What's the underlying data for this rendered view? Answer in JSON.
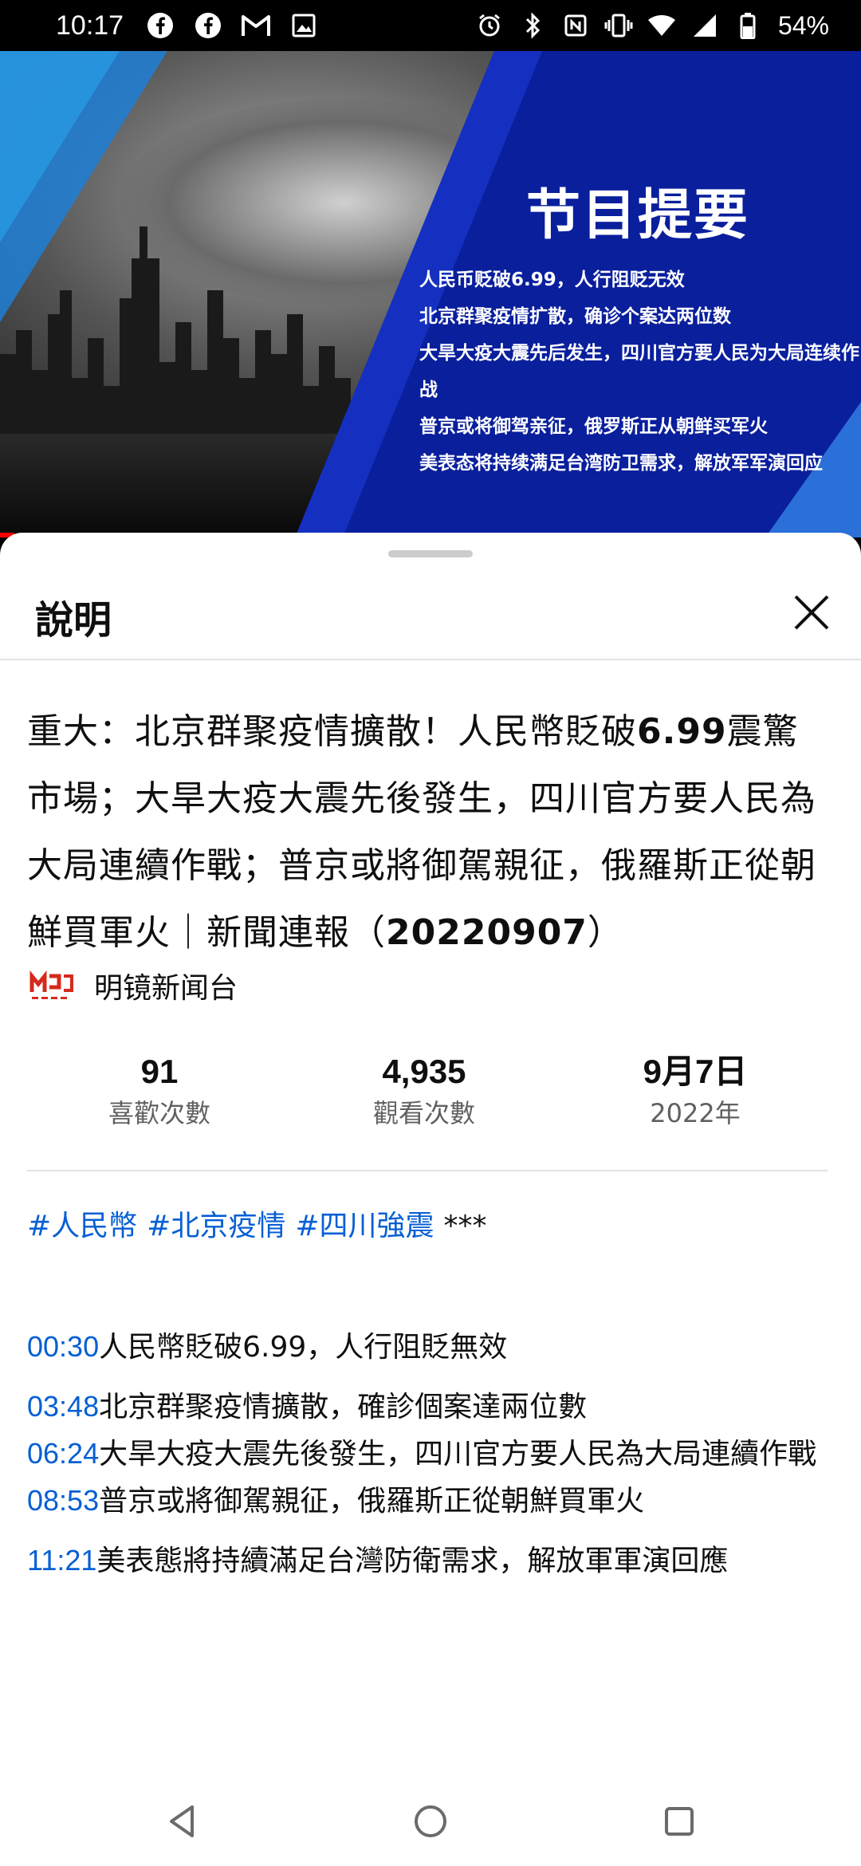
{
  "status_bar": {
    "time": "10:17",
    "left_icons": [
      "facebook-icon",
      "facebook-icon",
      "gmail-icon",
      "gallery-icon"
    ],
    "right_icons": [
      "alarm-icon",
      "bluetooth-icon",
      "nfc-icon",
      "vibrate-icon",
      "wifi-icon",
      "signal-icon",
      "battery-icon"
    ],
    "battery": "54%"
  },
  "thumbnail": {
    "heading": "节目提要",
    "lines": [
      "人民币贬破6.99，人行阻贬无效",
      "北京群聚疫情扩散，确诊个案达两位数",
      "大旱大疫大震先后发生，四川官方要人民为大局连续作战",
      "普京或将御驾亲征，俄罗斯正从朝鲜买军火",
      "美表态将持续满足台湾防卫需求，解放军军演回应"
    ]
  },
  "sheet": {
    "title": "說明",
    "video_title_parts": [
      "重大：北京群聚疫情擴散！人民幣貶破",
      "6.99",
      "震驚市場；大旱大疫大震先後發生，四川官方要人民為大局連續作戰；普京或將御駕親征，俄羅斯正從朝鮮買軍火｜新聞連報（",
      "20220907",
      "）"
    ],
    "channel": "明镜新闻台",
    "stats": [
      {
        "value": "91",
        "label": "喜歡次數"
      },
      {
        "value": "4,935",
        "label": "觀看次數"
      },
      {
        "value": "9月7日",
        "label": "2022年"
      }
    ],
    "tags": [
      "#人民幣",
      "#北京疫情",
      "#四川強震"
    ],
    "tags_suffix": "***",
    "chapters": [
      {
        "time": "00:30",
        "text": "人民幣貶破6.99，人行阻貶無效"
      },
      {
        "time": "03:48",
        "text": "北京群聚疫情擴散，確診個案達兩位數"
      },
      {
        "time": "06:24",
        "text": "大旱大疫大震先後發生，四川官方要人民為大局連續作戰"
      },
      {
        "time": "08:53",
        "text": "普京或將御駕親征，俄羅斯正從朝鮮買軍火"
      },
      {
        "time": "11:21",
        "text": "美表態將持續滿足台灣防衛需求，解放軍軍演回應"
      }
    ]
  },
  "nav": {
    "buttons": [
      "back-icon",
      "home-icon",
      "recents-icon"
    ]
  }
}
